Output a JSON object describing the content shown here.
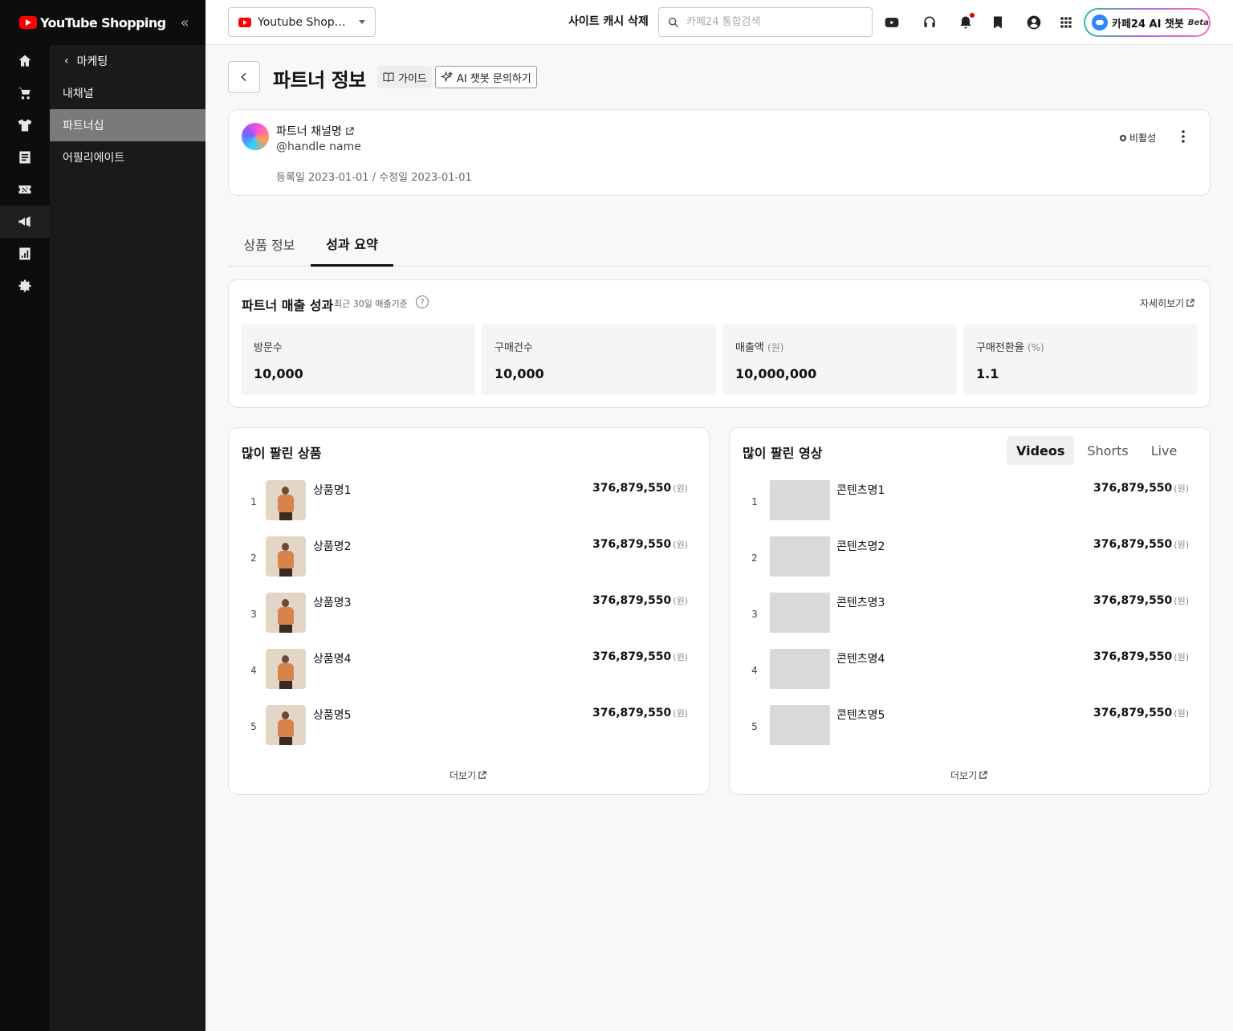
{
  "brand": {
    "name": "YouTube Shopping"
  },
  "rail": [
    {
      "name": "home-icon"
    },
    {
      "name": "cart-icon"
    },
    {
      "name": "shirt-icon"
    },
    {
      "name": "document-icon"
    },
    {
      "name": "coupon-icon"
    },
    {
      "name": "megaphone-icon"
    },
    {
      "name": "chart-icon"
    },
    {
      "name": "settings-icon"
    }
  ],
  "subnav": {
    "back_label": "마케팅",
    "items": [
      {
        "label": "내채널"
      },
      {
        "label": "파트너십"
      },
      {
        "label": "어필리에이트"
      }
    ],
    "active_index": 1
  },
  "topbar": {
    "shop_select": "Youtube Shopping",
    "cache_label": "사이트 캐시 삭제",
    "search_placeholder": "카페24 통합검색",
    "ai_label": "카페24 AI 챗봇",
    "ai_badge": "Beta"
  },
  "page": {
    "title": "파트너 정보",
    "guide_label": "가이드",
    "ai_chat_label": "AI 챗봇 문의하기"
  },
  "partner": {
    "name": "파트너 채널명",
    "handle": "@handle name",
    "dates": "등록일 2023-01-01 / 수정일 2023-01-01",
    "status": "비활성"
  },
  "tabs": [
    {
      "label": "상품 정보"
    },
    {
      "label": "성과 요약"
    }
  ],
  "performance": {
    "title": "파트너 매출 성과",
    "subtitle": "최근 30일 매출기준",
    "detail_link": "자세히보기",
    "stats": [
      {
        "label": "방문수",
        "unit": "",
        "value": "10,000"
      },
      {
        "label": "구매건수",
        "unit": "",
        "value": "10,000"
      },
      {
        "label": "매출액",
        "unit": "(원)",
        "value": "10,000,000"
      },
      {
        "label": "구매전환율",
        "unit": "(%)",
        "value": "1.1"
      }
    ]
  },
  "top_products": {
    "title": "많이 팔린 상품",
    "more_label": "더보기",
    "currency": "(원)",
    "items": [
      {
        "rank": "1",
        "name": "상품명1",
        "amount": "376,879,550"
      },
      {
        "rank": "2",
        "name": "상품명2",
        "amount": "376,879,550"
      },
      {
        "rank": "3",
        "name": "상품명3",
        "amount": "376,879,550"
      },
      {
        "rank": "4",
        "name": "상품명4",
        "amount": "376,879,550"
      },
      {
        "rank": "5",
        "name": "상품명5",
        "amount": "376,879,550"
      }
    ]
  },
  "top_videos": {
    "title": "많이 팔린 영상",
    "tabs": [
      "Videos",
      "Shorts",
      "Live"
    ],
    "more_label": "더보기",
    "currency": "(원)",
    "items": [
      {
        "rank": "1",
        "name": "콘텐츠명1",
        "amount": "376,879,550"
      },
      {
        "rank": "2",
        "name": "콘텐츠명2",
        "amount": "376,879,550"
      },
      {
        "rank": "3",
        "name": "콘텐츠명3",
        "amount": "376,879,550"
      },
      {
        "rank": "4",
        "name": "콘텐츠명4",
        "amount": "376,879,550"
      },
      {
        "rank": "5",
        "name": "콘텐츠명5",
        "amount": "376,879,550"
      }
    ]
  }
}
